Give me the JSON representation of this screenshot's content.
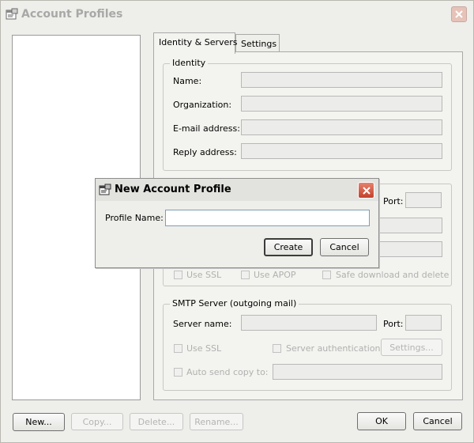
{
  "window": {
    "title": "Account Profiles"
  },
  "tabs": [
    {
      "label": "Identity & Servers"
    },
    {
      "label": "Settings"
    }
  ],
  "identity": {
    "group_label": "Identity",
    "name_label": "Name:",
    "organization_label": "Organization:",
    "email_label": "E-mail address:",
    "reply_label": "Reply address:"
  },
  "incoming": {
    "port_label": "Port:",
    "use_ssl_label": "Use SSL",
    "use_apop_label": "Use APOP",
    "safe_download_label": "Safe download and delete"
  },
  "smtp": {
    "group_label": "SMTP Server (outgoing mail)",
    "server_name_label": "Server name:",
    "port_label": "Port:",
    "use_ssl_label": "Use SSL",
    "server_auth_label": "Server authentication",
    "settings_button": "Settings...",
    "auto_send_label": "Auto send copy to:"
  },
  "footer": {
    "new_button": "New...",
    "copy_button": "Copy...",
    "delete_button": "Delete...",
    "rename_button": "Rename...",
    "ok_button": "OK",
    "cancel_button": "Cancel"
  },
  "dialog": {
    "title": "New Account Profile",
    "profile_name_label": "Profile Name:",
    "profile_name_value": "",
    "create_button": "Create",
    "cancel_button": "Cancel"
  },
  "colors": {
    "close_red": "#c2412b",
    "disabled_text": "#b0b0b0"
  }
}
